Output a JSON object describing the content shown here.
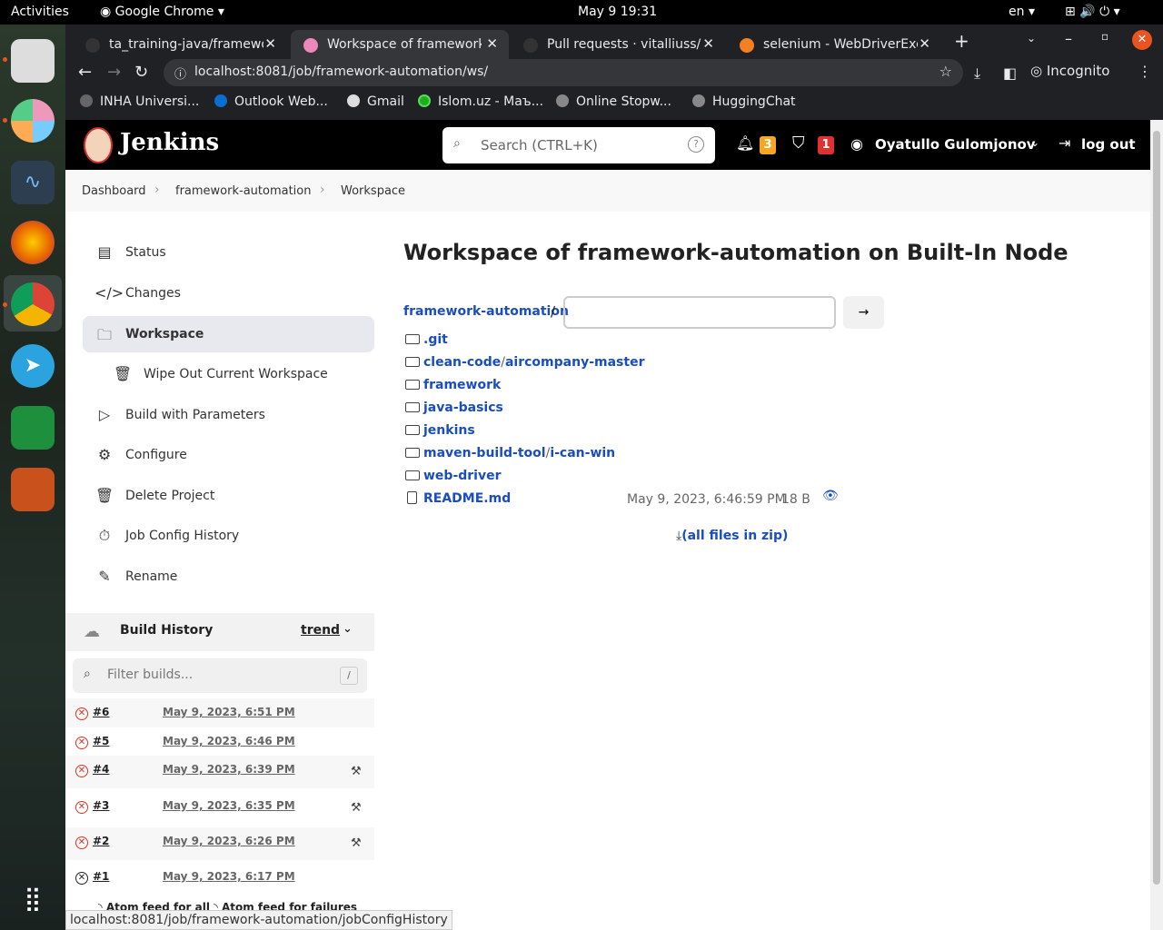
{
  "os": {
    "activities": "Activities",
    "app": "Google Chrome",
    "datetime": "May 9  19:31",
    "lang": "en"
  },
  "tabs": [
    {
      "title": "ta_training-java/framewo",
      "color": "#333"
    },
    {
      "title": "Workspace of framework",
      "color": "#e8b"
    },
    {
      "title": "Pull requests · vitalliuss/g",
      "color": "#333"
    },
    {
      "title": "selenium - WebDriverExce",
      "color": "#f48024"
    }
  ],
  "address": "localhost:8081/job/framework-automation/ws/",
  "incognito": "Incognito",
  "bookmarks": [
    "INHA Universi...",
    "Outlook Web...",
    "Gmail",
    "Islom.uz - Маъ...",
    "Online Stopw...",
    "HuggingChat"
  ],
  "jenkins": {
    "brand": "Jenkins",
    "search_placeholder": "Search (CTRL+K)",
    "notif_count": "3",
    "security_count": "1",
    "user": "Oyatullo Gulomjonov",
    "logout": "log out"
  },
  "breadcrumbs": [
    "Dashboard",
    "framework-automation",
    "Workspace"
  ],
  "sidebar": [
    "Status",
    "Changes",
    "Workspace",
    "Wipe Out Current Workspace",
    "Build with Parameters",
    "Configure",
    "Delete Project",
    "Job Config History",
    "Rename"
  ],
  "title": "Workspace of framework-automation on Built-In Node",
  "path_root": "framework-automation",
  "path_sep": "/",
  "files": [
    {
      "name": ".git"
    },
    {
      "name": "clean-code",
      "sub": "aircompany-master"
    },
    {
      "name": "framework"
    },
    {
      "name": "java-basics"
    },
    {
      "name": "jenkins"
    },
    {
      "name": "maven-build-tool",
      "sub": "i-can-win"
    },
    {
      "name": "web-driver"
    }
  ],
  "readme": {
    "name": "README.md",
    "date": "May 9, 2023, 6:46:59 PM",
    "size": "18 B"
  },
  "zip": "(all files in zip)",
  "history": {
    "title": "Build History",
    "trend": "trend",
    "filter_placeholder": "Filter builds...",
    "slash": "/",
    "builds": [
      {
        "num": "#6",
        "date": "May 9, 2023, 6:51 PM"
      },
      {
        "num": "#5",
        "date": "May 9, 2023, 6:46 PM"
      },
      {
        "num": "#4",
        "date": "May 9, 2023, 6:39 PM"
      },
      {
        "num": "#3",
        "date": "May 9, 2023, 6:35 PM"
      },
      {
        "num": "#2",
        "date": "May 9, 2023, 6:26 PM"
      },
      {
        "num": "#1",
        "date": "May 9, 2023, 6:17 PM"
      }
    ],
    "feeds": [
      "Atom feed for all",
      "Atom feed for failures"
    ]
  },
  "statusbar": "localhost:8081/job/framework-automation/jobConfigHistory"
}
